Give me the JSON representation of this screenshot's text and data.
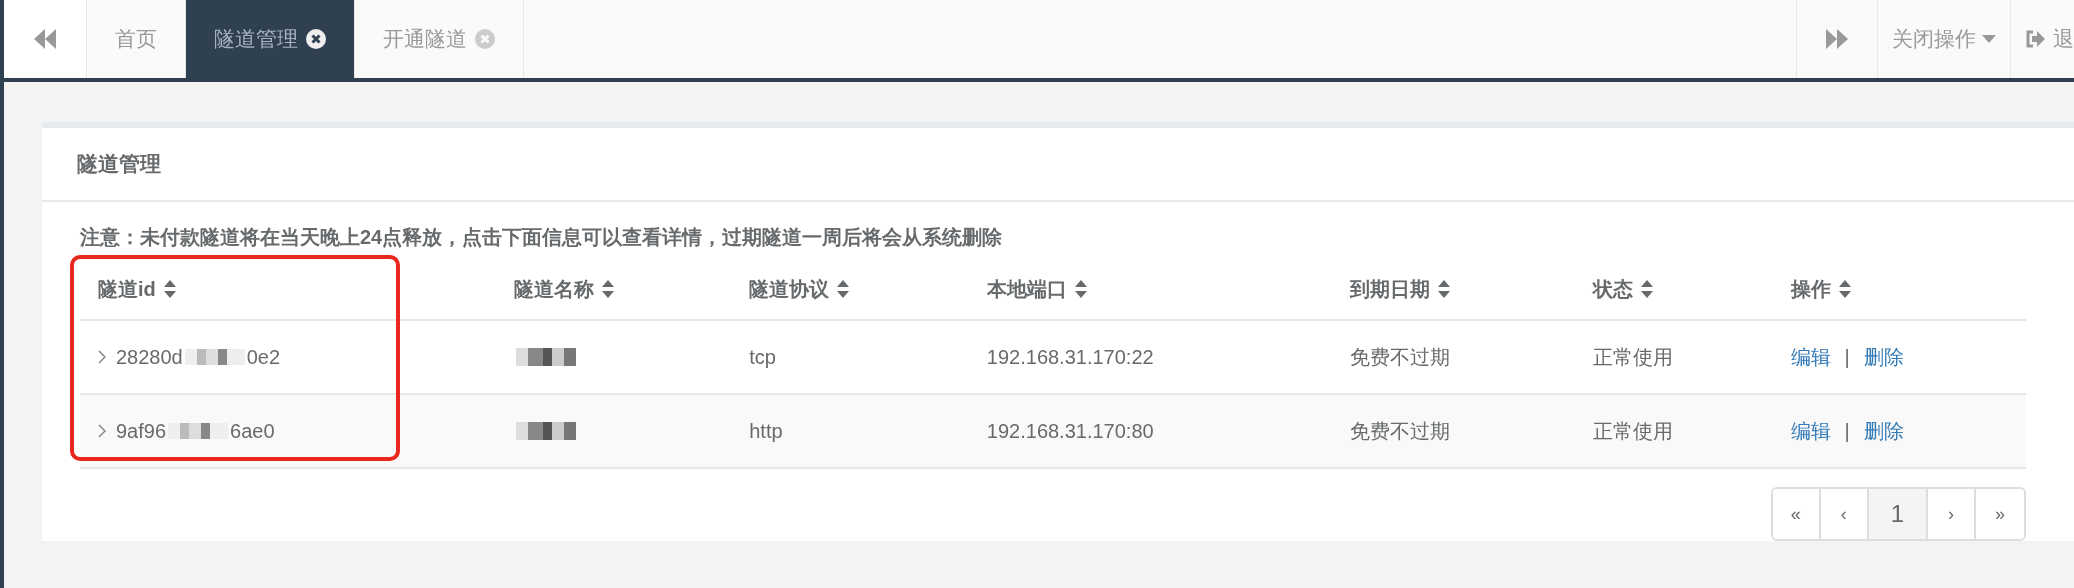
{
  "top_bar": {
    "tabs": [
      {
        "label": "首页",
        "closable": false,
        "selected": false
      },
      {
        "label": "隧道管理",
        "closable": true,
        "selected": true
      },
      {
        "label": "开通隧道",
        "closable": true,
        "selected": false
      }
    ],
    "close_menu": "关闭操作",
    "logout": "退"
  },
  "panel": {
    "title": "隧道管理",
    "notice": "注意：未付款隧道将在当天晚上24点释放，点击下面信息可以查看详情，过期隧道一周后将会从系统删除",
    "table": {
      "columns": [
        {
          "label": "隧道id",
          "highlighted": true
        },
        {
          "label": "隧道名称",
          "highlighted": false
        },
        {
          "label": "隧道协议",
          "highlighted": false
        },
        {
          "label": "本地端口",
          "highlighted": false
        },
        {
          "label": "到期日期",
          "highlighted": false
        },
        {
          "label": "状态",
          "highlighted": false
        },
        {
          "label": "操作",
          "highlighted": false
        }
      ],
      "rows": [
        {
          "id_start": "28280d",
          "id_end": "0e2",
          "protocol": "tcp",
          "port": "192.168.31.170:22",
          "expiry": "免费不过期",
          "status": "正常使用",
          "edit": "编辑",
          "separator": "|",
          "delete": "删除"
        },
        {
          "id_start": "9af96",
          "id_end": "6ae0",
          "protocol": "http",
          "port": "192.168.31.170:80",
          "expiry": "免费不过期",
          "status": "正常使用",
          "edit": "编辑",
          "separator": "|",
          "delete": "删除"
        }
      ]
    },
    "pagination": [
      {
        "label": "«",
        "selected": false
      },
      {
        "label": "‹",
        "selected": false
      },
      {
        "label": "1",
        "selected": true
      },
      {
        "label": "›",
        "selected": false
      },
      {
        "label": "»",
        "selected": false
      }
    ]
  }
}
